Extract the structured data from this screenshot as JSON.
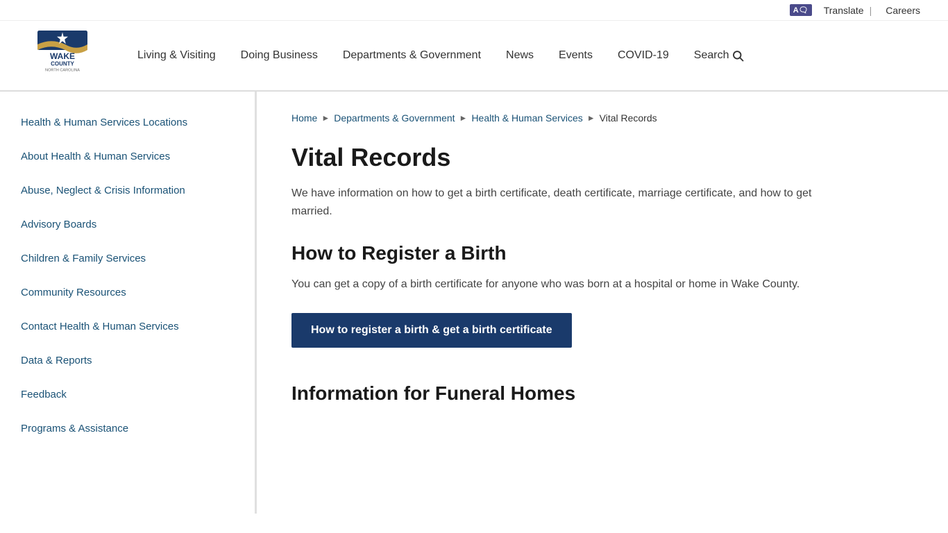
{
  "utility": {
    "translate_label": "Translate",
    "translate_icon": "A",
    "divider": "|",
    "careers_label": "Careers"
  },
  "header": {
    "logo_alt": "Wake County North Carolina",
    "nav_items": [
      {
        "label": "Living & Visiting",
        "id": "living-visiting"
      },
      {
        "label": "Doing Business",
        "id": "doing-business"
      },
      {
        "label": "Departments & Government",
        "id": "departments-government"
      },
      {
        "label": "News",
        "id": "news"
      },
      {
        "label": "Events",
        "id": "events"
      },
      {
        "label": "COVID-19",
        "id": "covid-19"
      },
      {
        "label": "Search",
        "id": "search"
      }
    ]
  },
  "sidebar": {
    "items": [
      {
        "label": "Health & Human Services Locations",
        "id": "hhs-locations"
      },
      {
        "label": "About Health & Human Services",
        "id": "about-hhs"
      },
      {
        "label": "Abuse, Neglect & Crisis Information",
        "id": "abuse-neglect"
      },
      {
        "label": "Advisory Boards",
        "id": "advisory-boards"
      },
      {
        "label": "Children & Family Services",
        "id": "children-family"
      },
      {
        "label": "Community Resources",
        "id": "community-resources"
      },
      {
        "label": "Contact Health & Human Services",
        "id": "contact-hhs"
      },
      {
        "label": "Data & Reports",
        "id": "data-reports"
      },
      {
        "label": "Feedback",
        "id": "feedback"
      },
      {
        "label": "Programs & Assistance",
        "id": "programs-assistance"
      }
    ]
  },
  "breadcrumb": {
    "items": [
      {
        "label": "Home",
        "id": "home"
      },
      {
        "label": "Departments & Government",
        "id": "departments"
      },
      {
        "label": "Health & Human Services",
        "id": "hhs"
      },
      {
        "label": "Vital Records",
        "id": "vital-records"
      }
    ]
  },
  "main": {
    "page_title": "Vital Records",
    "intro_text": "We have information on how to get a birth certificate, death certificate, marriage certificate, and how to get married.",
    "section1_title": "How to Register a Birth",
    "section1_text": "You can get a copy of a birth certificate for anyone who was born at a hospital or home in Wake County.",
    "cta_button_label": "How to register a birth & get a birth certificate",
    "section2_title": "Information for Funeral Homes"
  }
}
